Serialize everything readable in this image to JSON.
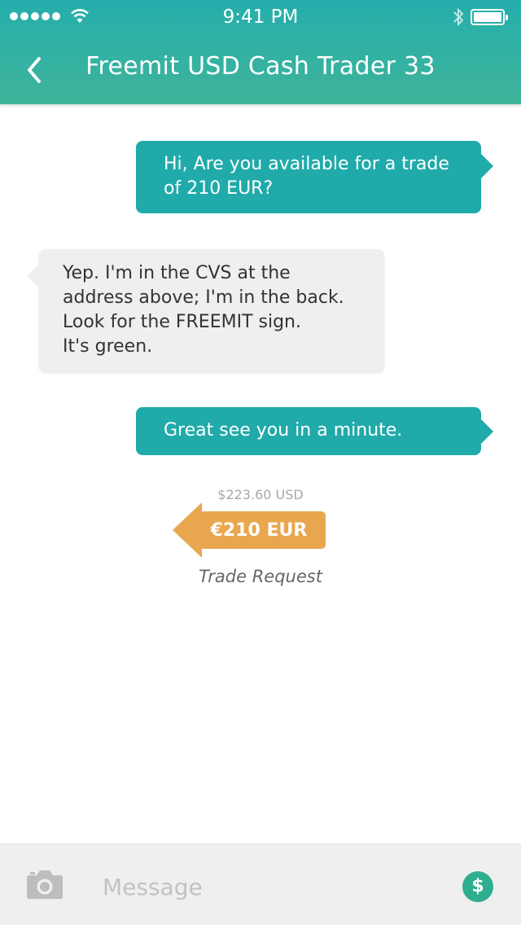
{
  "status_bar": {
    "time": "9:41 PM"
  },
  "header": {
    "title": "Freemit USD Cash Trader 33"
  },
  "messages": [
    {
      "direction": "outgoing",
      "lines": [
        "Hi, Are you available for a trade",
        "of 210 EUR?"
      ]
    },
    {
      "direction": "incoming",
      "lines": [
        "Yep. I'm in the CVS at the",
        "address above; I'm in the back.",
        "Look for the FREEMIT sign.",
        "It's green."
      ]
    },
    {
      "direction": "outgoing",
      "lines": [
        "Great see you in a minute."
      ]
    }
  ],
  "trade": {
    "usd_amount": "$223.60 USD",
    "eur_amount": "€210 EUR",
    "label": "Trade Request"
  },
  "composer": {
    "placeholder": "Message",
    "send_money_symbol": "$"
  },
  "colors": {
    "header": "#25aeac",
    "outgoing_bubble": "#21aaaa",
    "incoming_bubble": "#efefef",
    "trade_arrow": "#e8a74f",
    "dollar_button": "#2fae8f"
  }
}
